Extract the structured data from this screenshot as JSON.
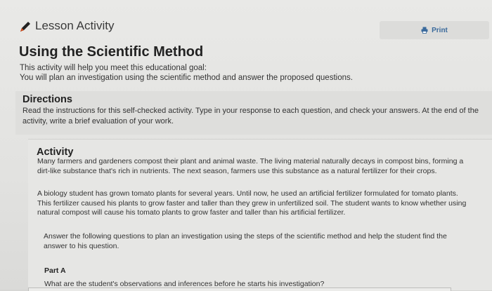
{
  "header": {
    "title": "Lesson Activity",
    "print_label": "Print",
    "icons": {
      "pencil": "pencil-icon",
      "print": "printer-icon"
    }
  },
  "main": {
    "title": "Using the Scientific Method",
    "goal_lines": [
      "This activity will help you meet this educational goal:",
      "You will plan an investigation using the scientific method and answer the proposed questions."
    ]
  },
  "directions": {
    "heading": "Directions",
    "text": "Read the instructions for this self-checked activity. Type in your response to each question, and check your answers. At the end of the activity, write a brief evaluation of your work."
  },
  "activity": {
    "heading": "Activity",
    "paragraphs": [
      "Many farmers and gardeners compost their plant and animal waste. The living material naturally decays in compost bins, forming a dirt-like substance that's rich in nutrients. The next season, farmers use this substance as a natural fertilizer for their crops.",
      "A biology student has grown tomato plants for several years. Until now, he used an artificial fertilizer formulated for tomato plants. This fertilizer caused his plants to grow faster and taller than they grew in unfertilized soil. The student wants to know whether using natural compost will cause his tomato plants to grow faster and taller than his artificial fertilizer.",
      "Answer the following questions to plan an investigation using the steps of the scientific method and help the student find the answer to his question."
    ],
    "part_a": {
      "label": "Part A",
      "question": "What are the student's observations and inferences before he starts his investigation?"
    }
  },
  "colors": {
    "link": "#3a6a9c",
    "pencil_body": "#222222",
    "pencil_tip": "#d04a1a"
  }
}
